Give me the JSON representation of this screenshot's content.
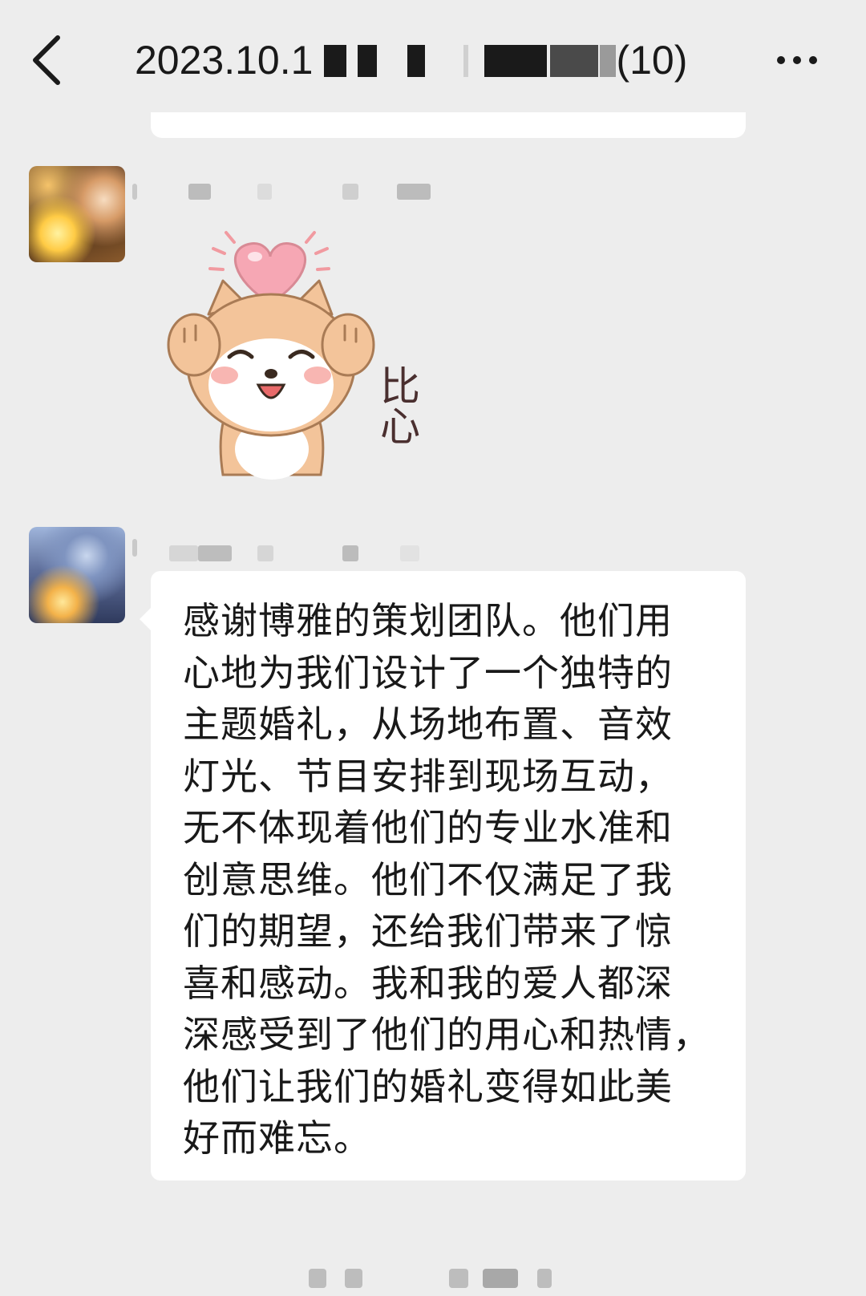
{
  "header": {
    "title_prefix": "2023.10.1",
    "title_suffix": "(10)",
    "back_icon": "chevron-left-icon",
    "more_icon": "more-dots-icon"
  },
  "messages": [
    {
      "type": "sticker",
      "sticker_caption": "比心",
      "avatar": "avatar-icon"
    },
    {
      "type": "text",
      "avatar": "avatar-icon",
      "lines": [
        "感谢博雅的策划团队。他们用",
        "心地为我们设计了一个独特的",
        "主题婚礼，从场地布置、音效",
        "灯光、节目安排到现场互动，",
        "无不体现着他们的专业水准和",
        "创意思维。他们不仅满足了我",
        "们的期望，还给我们带来了惊",
        "喜和感动。我和我的爱人都深",
        "深感受到了他们的用心和热情，",
        "他们让我们的婚礼变得如此美",
        "好而难忘。"
      ]
    }
  ],
  "colors": {
    "background": "#ededed",
    "bubble": "#ffffff",
    "text": "#191919"
  }
}
